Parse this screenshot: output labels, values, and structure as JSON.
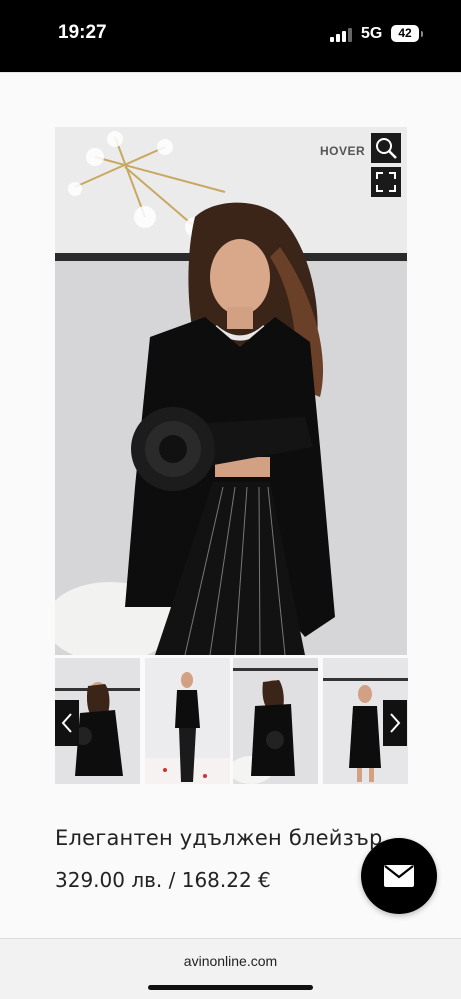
{
  "status_bar": {
    "time": "19:27",
    "network": "5G",
    "battery": "42"
  },
  "gallery": {
    "hover_label": "HOVER",
    "zoom_icon": "magnifier-icon",
    "fullscreen_icon": "fullscreen-icon",
    "thumbnail_count": 4
  },
  "product": {
    "title": "Елегантен удължен блейзър",
    "price": "329.00 лв. / 168.22 €"
  },
  "fab": {
    "icon": "mail-icon"
  },
  "browser": {
    "url": "avinonline.com"
  },
  "colors": {
    "accent": "#000000",
    "background": "#fafafa"
  }
}
